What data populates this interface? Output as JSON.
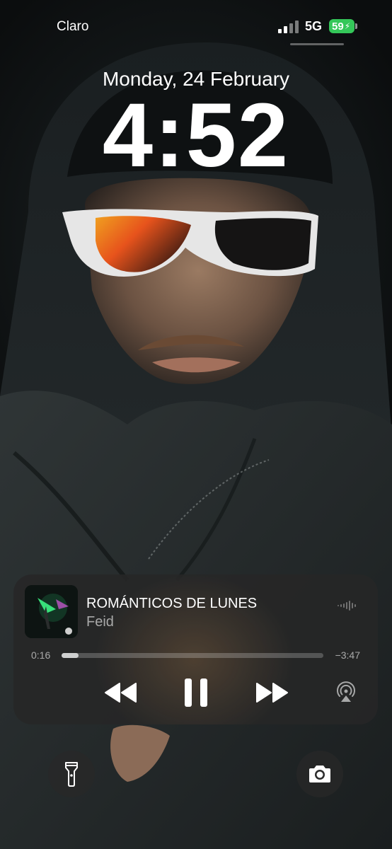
{
  "status_bar": {
    "carrier": "Claro",
    "network": "5G",
    "battery_level": "59",
    "signal_icon": "cellular-signal-icon",
    "battery_icon": "battery-charging-icon"
  },
  "lock_screen": {
    "date": "Monday, 24 February",
    "time": "4:52"
  },
  "now_playing": {
    "title": "ROMÁNTICOS DE LUNES",
    "artist": "Feid",
    "elapsed": "0:16",
    "remaining": "−3:47",
    "progress_fraction": 0.065,
    "controls": {
      "rewind_icon": "rewind-icon",
      "pause_icon": "pause-icon",
      "forward_icon": "fast-forward-icon",
      "airplay_icon": "airplay-audio-icon",
      "waveform_icon": "audio-waveform-icon"
    }
  },
  "quick_actions": {
    "left_icon": "flashlight-icon",
    "right_icon": "camera-icon"
  },
  "colors": {
    "battery_green": "#34c759",
    "text_primary": "#ffffff",
    "player_bg": "#262626"
  }
}
